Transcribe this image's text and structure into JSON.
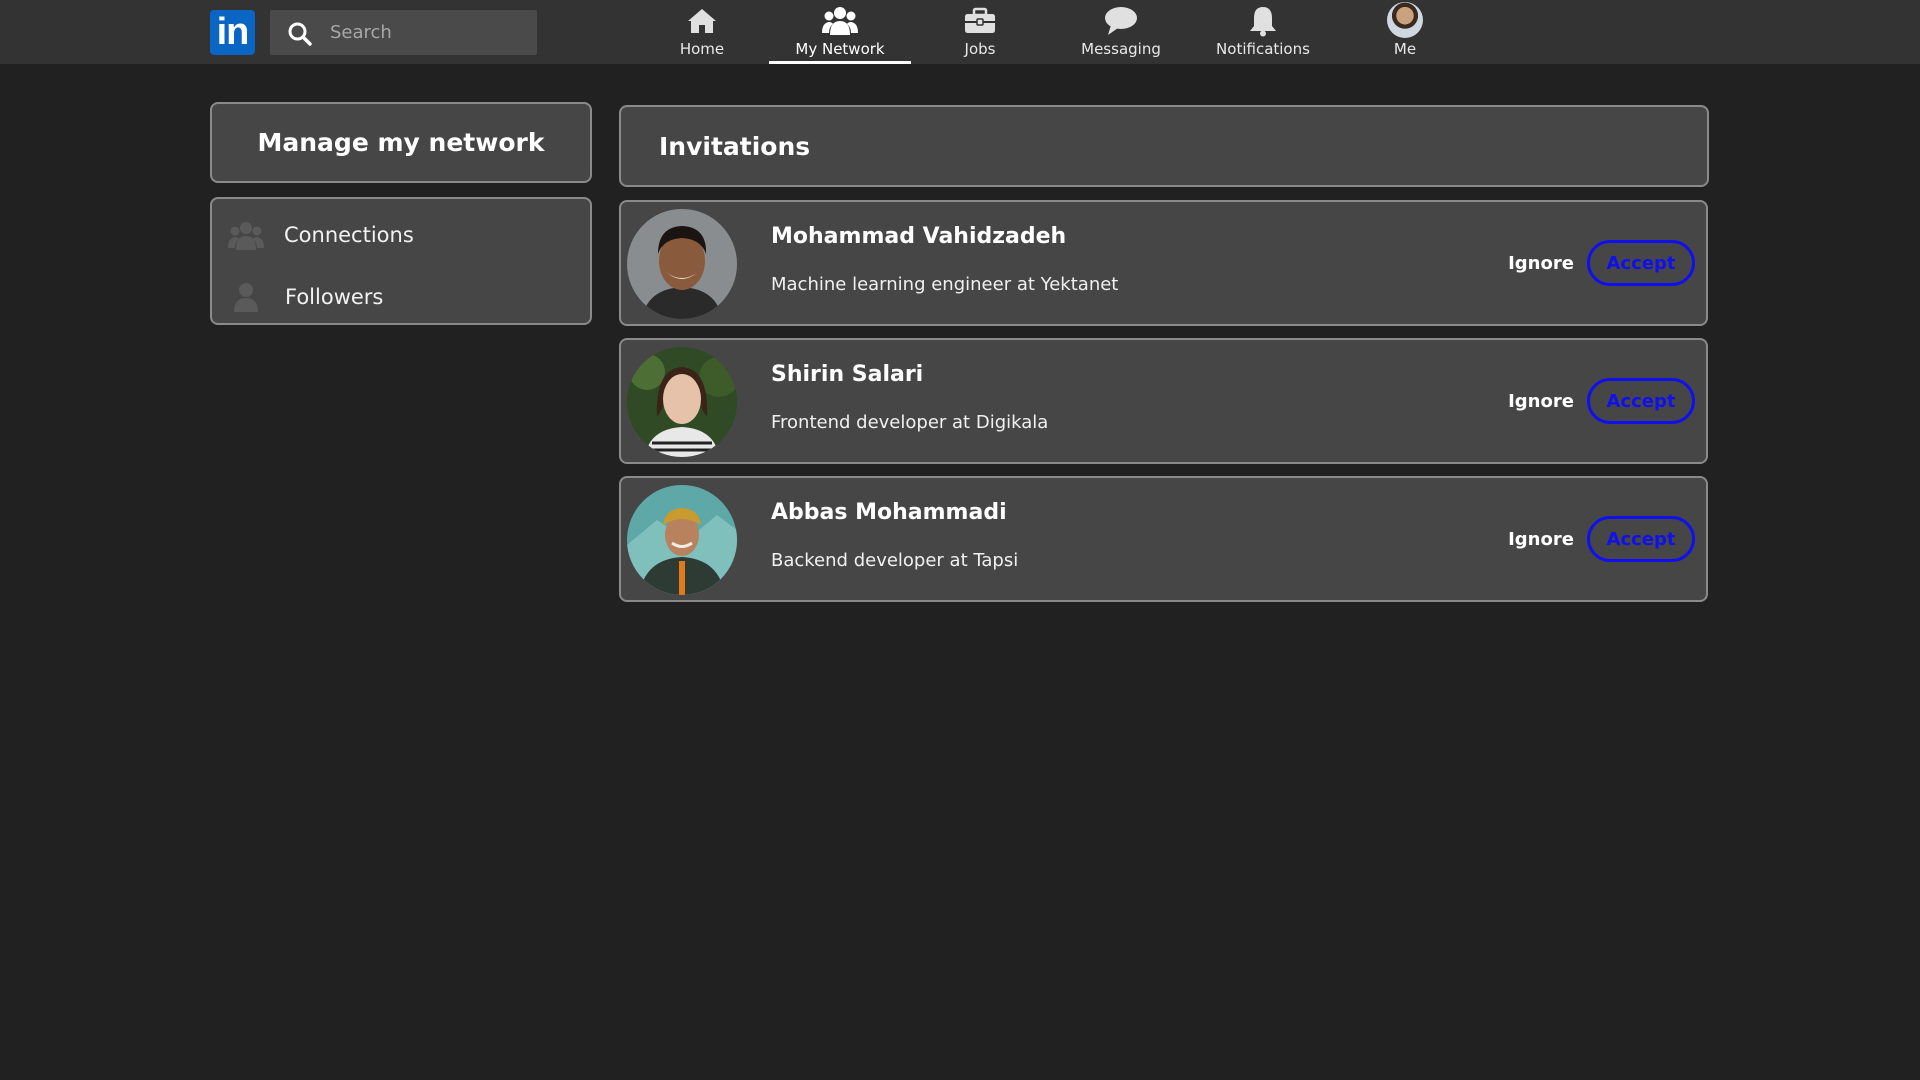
{
  "colors": {
    "background": "#212121",
    "topbar": "#333333",
    "card": "#464646",
    "card_border": "#8a8a8a",
    "brand": "#0a66c2",
    "accept": "#1010ee"
  },
  "topbar": {
    "logo_text": "in",
    "search": {
      "placeholder": "Search",
      "value": "",
      "icon": "search-icon"
    },
    "nav": [
      {
        "label": "Home",
        "icon": "home-icon",
        "active": false
      },
      {
        "label": "My Network",
        "icon": "network-icon",
        "active": true
      },
      {
        "label": "Jobs",
        "icon": "briefcase-icon",
        "active": false
      },
      {
        "label": "Messaging",
        "icon": "chat-bubble-icon",
        "active": false
      },
      {
        "label": "Notifications",
        "icon": "bell-icon",
        "active": false
      },
      {
        "label": "Me",
        "icon": "avatar",
        "active": false
      }
    ]
  },
  "sidebar": {
    "title": "Manage my network",
    "items": [
      {
        "label": "Connections",
        "icon": "people-icon"
      },
      {
        "label": "Followers",
        "icon": "person-icon"
      }
    ]
  },
  "invitations": {
    "title": "Invitations",
    "ignore_label": "Ignore",
    "accept_label": "Accept",
    "items": [
      {
        "name": "Mohammad Vahidzadeh",
        "headline": "Machine learning engineer at Yektanet"
      },
      {
        "name": "Shirin Salari",
        "headline": "Frontend developer at Digikala"
      },
      {
        "name": "Abbas Mohammadi",
        "headline": "Backend developer at Tapsi"
      }
    ]
  }
}
